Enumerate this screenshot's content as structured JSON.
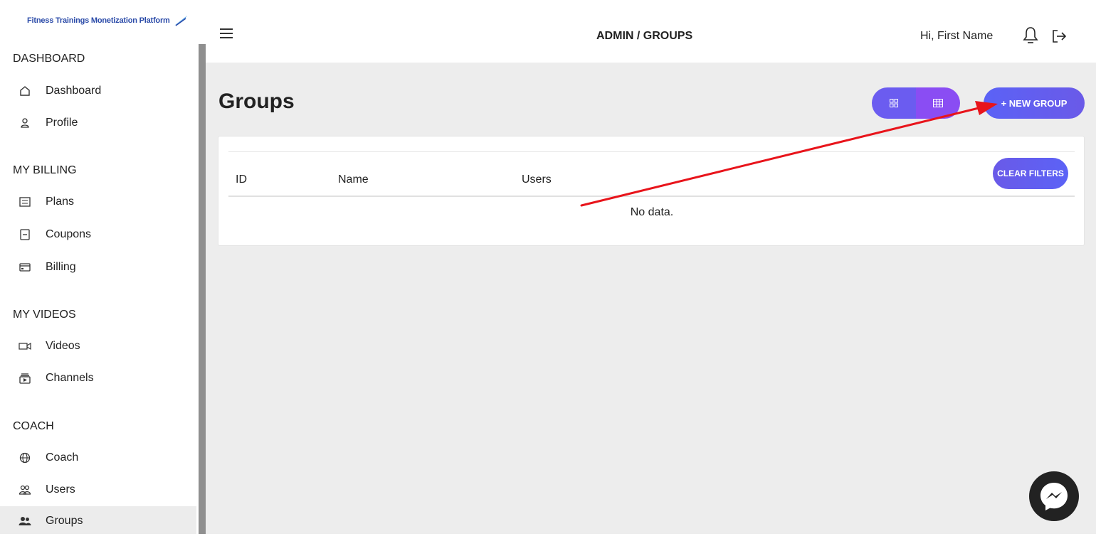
{
  "logo": {
    "text": "Fitness Trainings Monetization Platform"
  },
  "sidebar": {
    "sections": [
      {
        "title": "DASHBOARD"
      },
      {
        "title": "MY BILLING"
      },
      {
        "title": "MY VIDEOS"
      },
      {
        "title": "COACH"
      }
    ],
    "items": [
      {
        "label": "Dashboard",
        "icon": "home-icon"
      },
      {
        "label": "Profile",
        "icon": "user-icon"
      },
      {
        "label": "Plans",
        "icon": "list-icon"
      },
      {
        "label": "Coupons",
        "icon": "coupon-icon"
      },
      {
        "label": "Billing",
        "icon": "credit-card-icon"
      },
      {
        "label": "Videos",
        "icon": "video-icon"
      },
      {
        "label": "Channels",
        "icon": "channel-icon"
      },
      {
        "label": "Coach",
        "icon": "globe-icon"
      },
      {
        "label": "Users",
        "icon": "users-icon"
      },
      {
        "label": "Groups",
        "icon": "groups-icon",
        "active": true
      }
    ]
  },
  "header": {
    "breadcrumb": "ADMIN / GROUPS",
    "greeting": "Hi, First Name"
  },
  "main": {
    "title": "Groups",
    "new_group_label": "+ NEW GROUP",
    "clear_filters_label": "CLEAR FILTERS",
    "table": {
      "columns": [
        "ID",
        "Name",
        "Users"
      ],
      "empty_text": "No data."
    }
  },
  "colors": {
    "accent": "#6b5cf0",
    "annotation_arrow": "#e8141b",
    "active_nav_bg": "#ececec",
    "main_bg": "#ededed"
  }
}
